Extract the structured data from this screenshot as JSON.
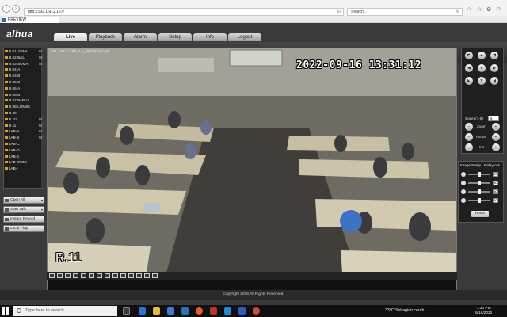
{
  "browser": {
    "url": "http://192.168.2.167/",
    "search_placeholder": "Search...",
    "tab_title": "PREVIEW"
  },
  "app": {
    "brand": "alhua",
    "tabs": [
      "Live",
      "Playback",
      "Alarm",
      "Setup",
      "Info",
      "Logout"
    ],
    "active_tab": "Live",
    "footer": "Copyright 2015,All Rights Reserved."
  },
  "channels": [
    {
      "name": "R.01-JAWA",
      "m": "M"
    },
    {
      "name": "R.02-BALI",
      "m": "M"
    },
    {
      "name": "R.03-SUMAT",
      "m": "M"
    },
    {
      "name": "R.04-A",
      "m": ""
    },
    {
      "name": "R.04-B",
      "m": ""
    },
    {
      "name": "R.05-B",
      "m": ""
    },
    {
      "name": "R.06-A",
      "m": ""
    },
    {
      "name": "R.06-B",
      "m": ""
    },
    {
      "name": "R.07-PAPUA",
      "m": ""
    },
    {
      "name": "R.08-LOMBC",
      "m": ""
    },
    {
      "name": "R.09",
      "m": ""
    },
    {
      "name": "R.10",
      "m": "M"
    },
    {
      "name": "R.11",
      "m": "M"
    },
    {
      "name": "LAB-A",
      "m": "M"
    },
    {
      "name": "LAB-B",
      "m": "M"
    },
    {
      "name": "LAB-C",
      "m": ""
    },
    {
      "name": "LAB-D",
      "m": ""
    },
    {
      "name": "LAB-E",
      "m": ""
    },
    {
      "name": "LAB-JRGN",
      "m": ""
    },
    {
      "name": "LAB-I",
      "m": ""
    }
  ],
  "left_buttons": {
    "open_all": "Open All",
    "start_talk": "Start Talk",
    "instant_record": "Instant Record",
    "local_play": "Local Play"
  },
  "video": {
    "osd_info": "192.168.2.167_1A_8026kbps_M",
    "timestamp": "2022-09-16 13:31:12",
    "channel_label": "R.11"
  },
  "ptz": {
    "speed_label": "Speed(1-8)",
    "speed_value": "5",
    "zoom": "Zoom",
    "focus": "Focus",
    "iris": "Iris"
  },
  "image_setup": {
    "title": "Image Setup",
    "relay": "Relay-out",
    "rows": [
      {
        "icon": "brightness-icon",
        "value": "50"
      },
      {
        "icon": "contrast-icon",
        "value": "50"
      },
      {
        "icon": "saturation-icon",
        "value": "50"
      },
      {
        "icon": "hue-icon",
        "value": "50"
      }
    ],
    "reset": "Reset"
  },
  "taskbar": {
    "search_placeholder": "Type here to search",
    "weather": "33°C  Sebagian cerah",
    "time": "1:34 PM",
    "date": "9/16/2022"
  },
  "colors": {
    "accent_orange": "#e3a400",
    "app_bg": "#3a3a3a"
  }
}
